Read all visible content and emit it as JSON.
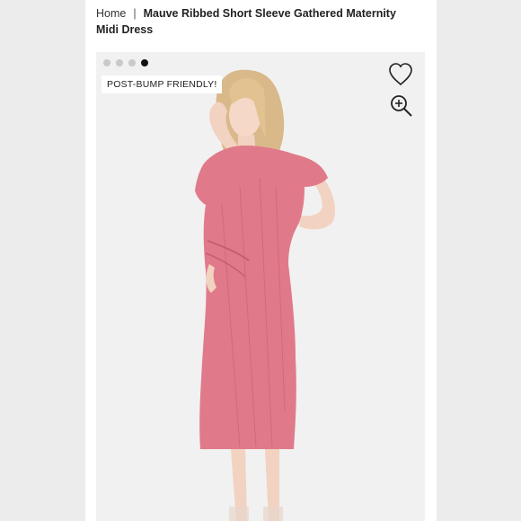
{
  "breadcrumb": {
    "home_label": "Home",
    "separator": "|",
    "current_label": "Mauve Ribbed Short Sleeve Gathered Maternity Midi Dress"
  },
  "gallery": {
    "badge_text": "POST-BUMP FRIENDLY!",
    "dots": 4,
    "active_dot": 4,
    "icons": [
      "heart-icon",
      "zoom-in-icon"
    ],
    "dress_color": "#e07a8a",
    "background_color": "#f1f1f1"
  }
}
